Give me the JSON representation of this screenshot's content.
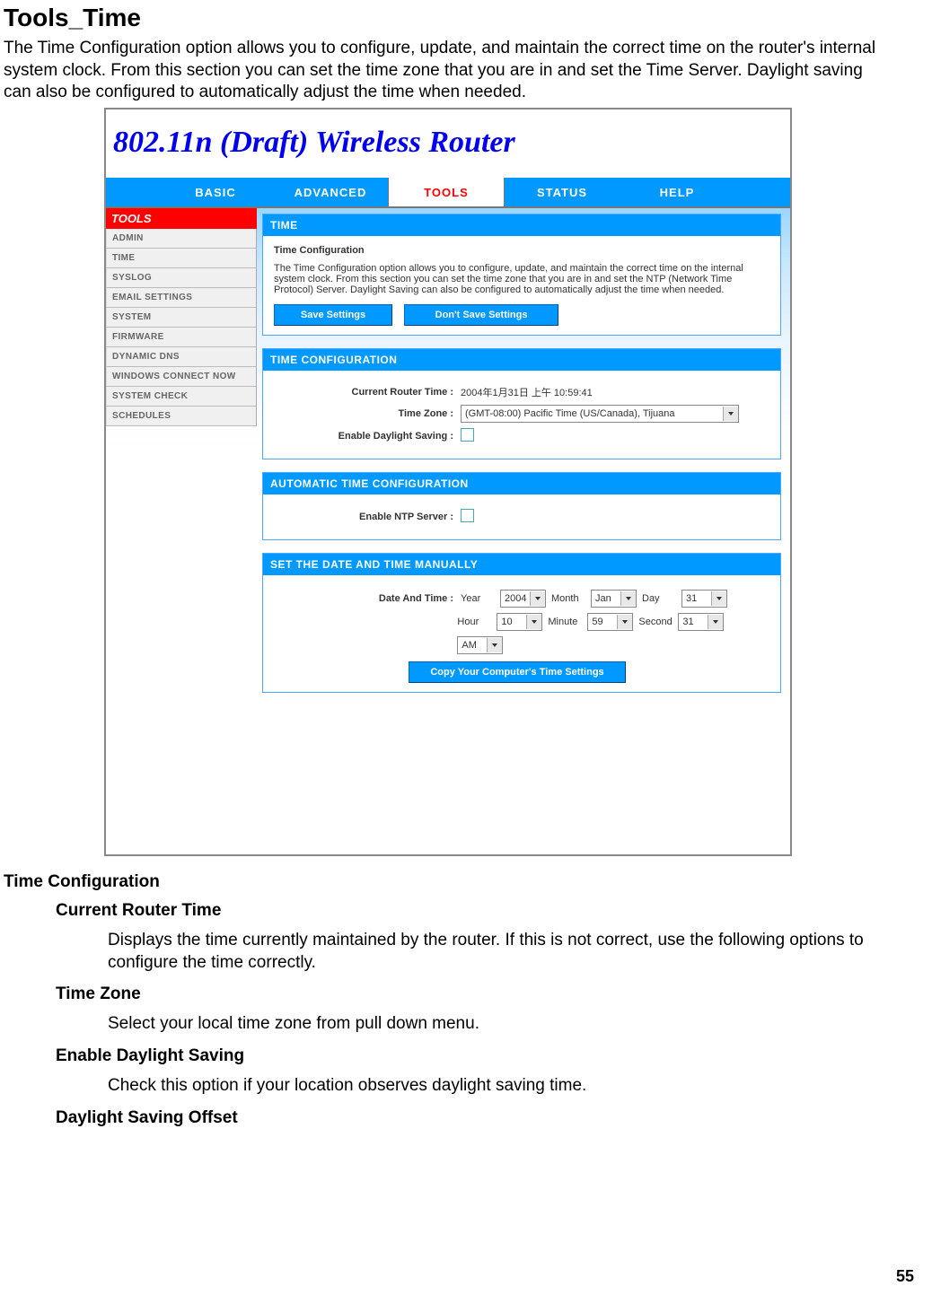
{
  "doc": {
    "title": "Tools_Time",
    "intro": "The Time Configuration option allows you to configure, update, and maintain the correct time on the router's internal system clock. From this section you can set the time zone that you are in and set the Time Server. Daylight saving can also be configured to automatically adjust the time when needed.",
    "h2": "Time Configuration",
    "sections": [
      {
        "h": "Current Router Time",
        "p": "Displays the time currently maintained by the router. If this is not correct, use the following options to configure the time correctly."
      },
      {
        "h": "Time Zone",
        "p": "Select your local time zone from pull down menu."
      },
      {
        "h": "Enable Daylight Saving",
        "p": "Check this option if your location observes daylight saving time."
      },
      {
        "h": "Daylight Saving Offset",
        "p": ""
      }
    ],
    "page_num": "55"
  },
  "router": {
    "banner": "802.11n (Draft) Wireless Router",
    "nav": [
      "BASIC",
      "ADVANCED",
      "TOOLS",
      "STATUS",
      "HELP"
    ],
    "nav_active": "TOOLS",
    "side_header": "TOOLS",
    "side_items": [
      "ADMIN",
      "TIME",
      "SYSLOG",
      "EMAIL SETTINGS",
      "SYSTEM",
      "FIRMWARE",
      "DYNAMIC DNS",
      "WINDOWS CONNECT NOW",
      "SYSTEM CHECK",
      "SCHEDULES"
    ],
    "panel_time": {
      "title": "TIME",
      "sub": "Time Configuration",
      "desc": "The Time Configuration option allows you to configure, update, and maintain the correct time on the internal system clock. From this section you can set the time zone that you are in and set the NTP (Network Time Protocol) Server. Daylight Saving can also be configured to automatically adjust the time when needed.",
      "save": "Save Settings",
      "dont": "Don't Save Settings"
    },
    "panel_cfg": {
      "title": "TIME CONFIGURATION",
      "l_current": "Current Router Time :",
      "v_current": "2004年1月31日 上午 10:59:41",
      "l_tz": "Time Zone :",
      "v_tz": "(GMT-08:00) Pacific Time (US/Canada), Tijuana",
      "l_ds": "Enable Daylight Saving :"
    },
    "panel_auto": {
      "title": "AUTOMATIC TIME CONFIGURATION",
      "l_ntp": "Enable NTP Server :"
    },
    "panel_manual": {
      "title": "SET THE DATE AND TIME MANUALLY",
      "l_dt": "Date And Time :",
      "copy": "Copy Your Computer's Time Settings",
      "fields": {
        "year_l": "Year",
        "year_v": "2004",
        "month_l": "Month",
        "month_v": "Jan",
        "day_l": "Day",
        "day_v": "31",
        "hour_l": "Hour",
        "hour_v": "10",
        "minute_l": "Minute",
        "minute_v": "59",
        "second_l": "Second",
        "second_v": "31",
        "ampm_v": "AM"
      }
    }
  }
}
